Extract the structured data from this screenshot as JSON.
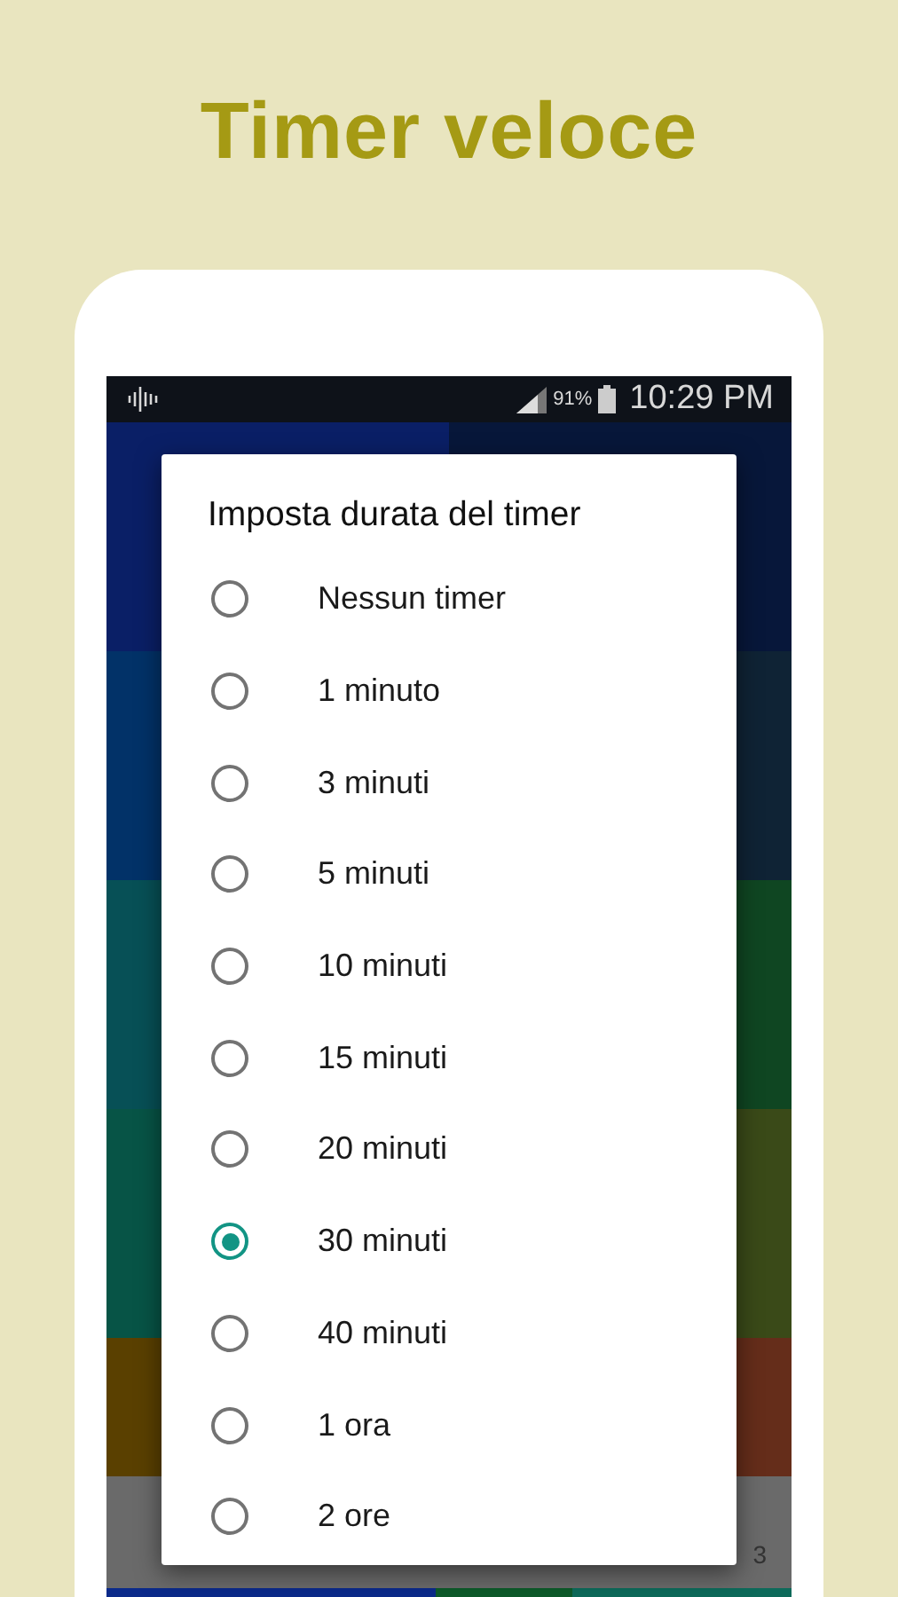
{
  "headline": "Timer veloce",
  "status_bar": {
    "battery_percent": "91%",
    "time": "10:29 PM"
  },
  "background_tiles": [
    {
      "color": "#0a1f66"
    },
    {
      "color": "#07173a"
    },
    {
      "color": "#023268"
    },
    {
      "color": "#0f2335"
    },
    {
      "color": "#075056"
    },
    {
      "color": "#0f4622"
    },
    {
      "color": "#075446"
    },
    {
      "color": "#3a4a18"
    },
    {
      "color": "#5a4000"
    },
    {
      "color": "#652d1a"
    },
    {
      "color": "#6a6a6a"
    },
    {
      "color": "#6a6a6a"
    }
  ],
  "background_fragment": "3",
  "dialog": {
    "title": "Imposta durata del timer",
    "options": [
      {
        "label": "Nessun timer",
        "selected": false
      },
      {
        "label": "1 minuto",
        "selected": false
      },
      {
        "label": "3 minuti",
        "selected": false
      },
      {
        "label": "5 minuti",
        "selected": false
      },
      {
        "label": "10 minuti",
        "selected": false
      },
      {
        "label": "15 minuti",
        "selected": false
      },
      {
        "label": "20 minuti",
        "selected": false
      },
      {
        "label": "30 minuti",
        "selected": true
      },
      {
        "label": "40 minuti",
        "selected": false
      },
      {
        "label": "1 ora",
        "selected": false
      },
      {
        "label": "2 ore",
        "selected": false
      }
    ]
  }
}
